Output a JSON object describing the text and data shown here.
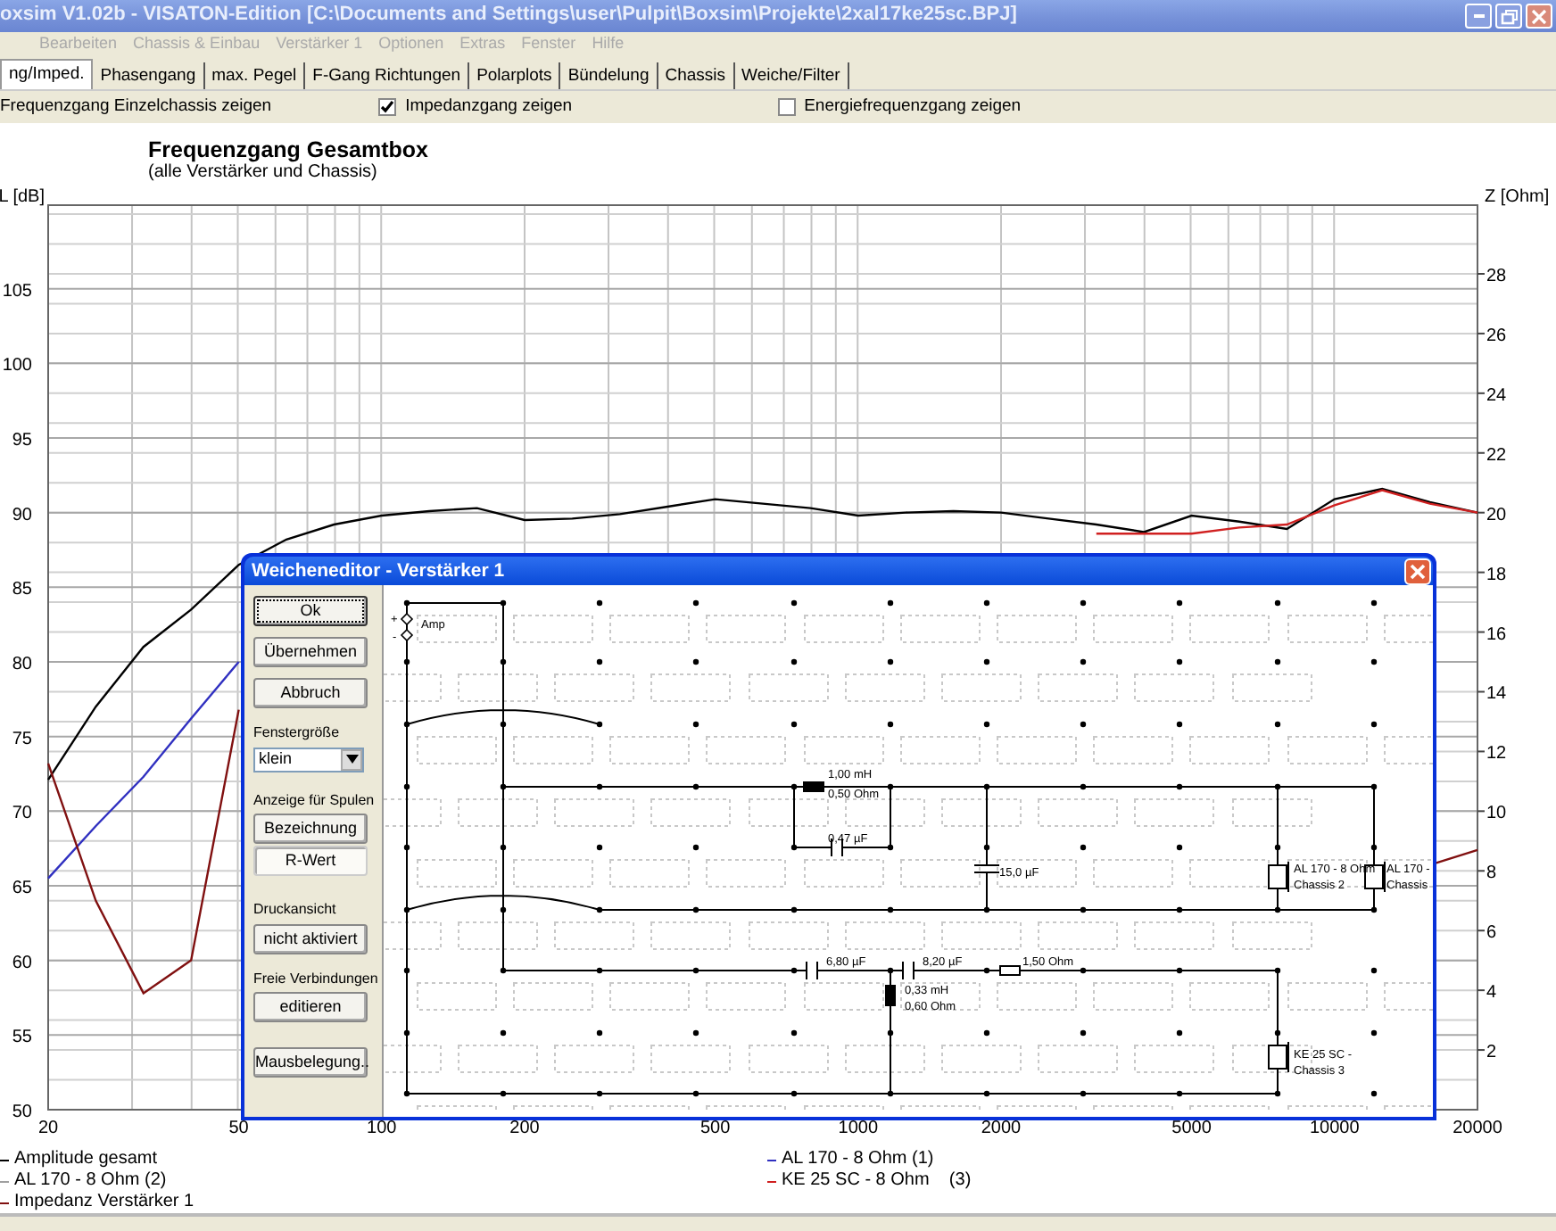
{
  "window": {
    "title": "oxsim V1.02b - VISATON-Edition [C:\\Documents and Settings\\user\\Pulpit\\Boxsim\\Projekte\\2xal17ke25sc.BPJ]"
  },
  "menu": [
    {
      "label": "Bearbeiten",
      "disabled": true
    },
    {
      "label": "Chassis & Einbau",
      "disabled": true
    },
    {
      "label": "Verstärker 1",
      "disabled": true
    },
    {
      "label": "Optionen",
      "disabled": true
    },
    {
      "label": "Extras",
      "disabled": true
    },
    {
      "label": "Fenster",
      "disabled": true
    },
    {
      "label": "Hilfe",
      "disabled": true
    }
  ],
  "tabs": [
    {
      "label": "ng/Imped.",
      "selected": true
    },
    {
      "label": "Phasengang",
      "selected": false
    },
    {
      "label": "max. Pegel",
      "selected": false
    },
    {
      "label": "F-Gang Richtungen",
      "selected": false
    },
    {
      "label": "Polarplots",
      "selected": false
    },
    {
      "label": "Bündelung",
      "selected": false
    },
    {
      "label": "Chassis",
      "selected": false
    },
    {
      "label": "Weiche/Filter",
      "selected": false
    }
  ],
  "options": [
    {
      "label": "Frequenzgang Einzelchassis zeigen"
    },
    {
      "label": "Impedanzgang zeigen",
      "checked": true
    },
    {
      "label": "Energiefrequenzgang zeigen",
      "checked": false
    }
  ],
  "chart": {
    "title": "Frequenzgang Gesamtbox",
    "subtitle": "(alle Verstärker und Chassis)",
    "chart_data": {
      "type": "line",
      "ylabel": "L [dB]",
      "y2label": "Z [Ohm]",
      "ylim": [
        50,
        110.6
      ],
      "y2lim": [
        0,
        30.3
      ],
      "y2ticks": [
        28,
        26,
        24,
        22,
        20,
        18,
        16,
        14,
        12,
        10,
        8,
        6,
        4,
        2
      ],
      "yticks": [
        50,
        55,
        60,
        65,
        70,
        75,
        80,
        85,
        90,
        95,
        100,
        105
      ],
      "grid": true,
      "categories": [
        "20",
        null,
        null,
        null,
        "50",
        null,
        null,
        "100",
        null,
        null,
        "200",
        null,
        null,
        null,
        "500",
        null,
        null,
        "1000",
        null,
        null,
        "2000",
        null,
        null,
        null,
        "5000",
        null,
        null,
        "10000",
        null,
        null,
        "20000"
      ],
      "series": [
        {
          "name": "Amplitude gesamt",
          "color": "#000000",
          "values": [
            72.1,
            77.0,
            81.0,
            83.5,
            86.5,
            88.2,
            89.2,
            89.8,
            90.1,
            90.3,
            89.5,
            89.6,
            89.9,
            90.4,
            90.9,
            90.6,
            90.3,
            89.8,
            90.0,
            90.1,
            90.0,
            89.6,
            89.2,
            88.7,
            89.8,
            89.4,
            88.9,
            90.9,
            91.6,
            90.7,
            90.0
          ]
        },
        {
          "name": "AL 170 - 8 Ohm (1)",
          "color": "#3030c0",
          "values": [
            65.5,
            69.0,
            72.3,
            76.2,
            80.0,
            null,
            null,
            null,
            null,
            null,
            null,
            null,
            null,
            null,
            null,
            null,
            null,
            null,
            null,
            null,
            null,
            null,
            null,
            null,
            null,
            null,
            null,
            null,
            null,
            null,
            null
          ]
        },
        {
          "name": "AL 170 - 8 Ohm (2)",
          "color": "#a0a0a0",
          "values": [
            null,
            null,
            null,
            null,
            null,
            null,
            null,
            null,
            null,
            null,
            null,
            null,
            null,
            null,
            null,
            null,
            null,
            null,
            null,
            null,
            null,
            null,
            null,
            null,
            null,
            null,
            null,
            null,
            null,
            null,
            null
          ]
        },
        {
          "name": "KE 25 SC - 8 Ohm    (3)",
          "color": "#d02020",
          "values": [
            null,
            null,
            null,
            null,
            null,
            null,
            null,
            null,
            null,
            null,
            null,
            null,
            null,
            null,
            null,
            null,
            null,
            null,
            null,
            null,
            null,
            null,
            88.6,
            88.6,
            88.6,
            89.0,
            89.2,
            90.5,
            91.5,
            90.6,
            90.0
          ]
        },
        {
          "name": "Impedanz Verstärker 1",
          "axis": "y2",
          "color": "#801010",
          "values": [
            11.6,
            7.0,
            3.9,
            5.0,
            13.4,
            null,
            null,
            null,
            null,
            null,
            null,
            null,
            null,
            null,
            null,
            null,
            null,
            null,
            null,
            null,
            null,
            null,
            null,
            null,
            null,
            null,
            null,
            null,
            null,
            8.2,
            8.7
          ]
        }
      ]
    }
  },
  "dialog": {
    "title": "Weicheneditor - Verstärker 1",
    "buttons": [
      {
        "label": "Ok",
        "focused": true
      },
      {
        "label": "Übernehmen",
        "focused": false
      },
      {
        "label": "Abbruch",
        "focused": false
      }
    ],
    "window_size": {
      "label": "Fenstergröße",
      "value": "klein"
    },
    "coil_display": {
      "label": "Anzeige für Spulen",
      "options": [
        {
          "label": "Bezeichnung",
          "selected": false
        },
        {
          "label": "R-Wert",
          "selected": true
        }
      ]
    },
    "print_view": {
      "label": "Druckansicht",
      "button": "nicht aktiviert"
    },
    "free_connections": {
      "label": "Freie Verbindungen",
      "button": "editieren"
    },
    "mouse_button": "Mausbelegung..",
    "schematic": {
      "amp": "Amp",
      "terminals": [
        "+",
        "-"
      ],
      "labels": [
        "1,00 mH",
        "0,50 Ohm",
        "0,47 µF",
        "15,0 µF",
        "AL 170 - 8 Ohm",
        "Chassis 2",
        "AL 170 -",
        "Chassis",
        "6,80 µF",
        "8,20 µF",
        "1,50 Ohm",
        "0,33 mH",
        "0,60 Ohm",
        "KE 25 SC -",
        "Chassis 3"
      ]
    }
  }
}
